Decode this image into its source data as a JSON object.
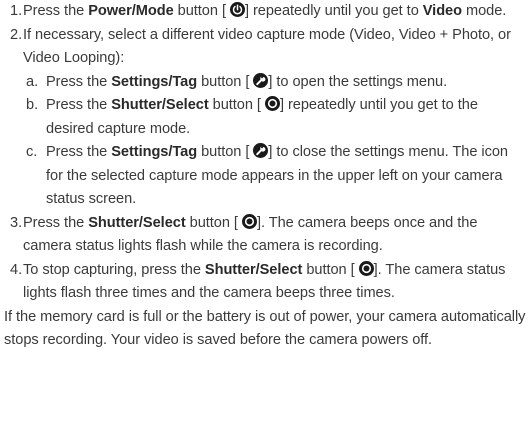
{
  "steps": [
    {
      "num": "1.",
      "pre": "Press the ",
      "button": "Power/Mode",
      "mid": " button [",
      "post": "] repeatedly until you get to ",
      "mode": "Video",
      "end": " mode."
    },
    {
      "num": "2.",
      "text": "If necessary, select a different video capture mode (Video, Video + Photo, or Video Looping):"
    },
    {
      "num": "3.",
      "pre": "Press the ",
      "button": "Shutter/Select",
      "mid": " button [",
      "post": "]. The camera beeps once and the camera status lights flash while the camera is recording."
    },
    {
      "num": "4.",
      "pre": "To stop capturing, press the ",
      "button": "Shutter/Select",
      "mid": " button [",
      "post": "]. The camera status lights flash three times and the camera beeps three times."
    }
  ],
  "substeps": [
    {
      "letter": "a.",
      "pre": "Press the ",
      "button": "Settings/Tag",
      "mid": " button [",
      "post": "] to open the settings menu."
    },
    {
      "letter": "b.",
      "pre": "Press the ",
      "button": "Shutter/Select",
      "mid": " button [",
      "post": "] repeatedly until you get to the desired capture mode."
    },
    {
      "letter": "c.",
      "pre": "Press the ",
      "button": "Settings/Tag",
      "mid": " button [",
      "post": "] to close the settings menu. The icon for the selected capture mode appears in the upper left on your camera status screen."
    }
  ],
  "footer": "If the memory card is full or the battery is out of power, your camera automatically stops recording. Your video is saved before the camera powers off.",
  "icons": {
    "power": "power-icon",
    "settings": "wrench-icon",
    "shutter": "shutter-icon"
  }
}
